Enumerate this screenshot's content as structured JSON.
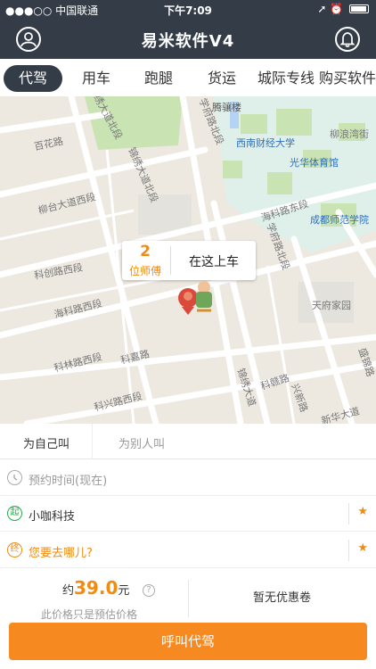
{
  "status_bar": {
    "carrier": "●●●○○ 中国联通",
    "time": "下午7:09",
    "right_icons": "➚ ⏰"
  },
  "header": {
    "title": "易米软件V4",
    "left_icon": "user-icon",
    "right_icon": "bell-icon"
  },
  "tabs": [
    {
      "label": "代驾",
      "active": true
    },
    {
      "label": "用车",
      "active": false
    },
    {
      "label": "跑腿",
      "active": false
    },
    {
      "label": "货运",
      "active": false
    },
    {
      "label": "城际专线",
      "active": false
    },
    {
      "label": "购买软件",
      "active": false
    }
  ],
  "map": {
    "labels": {
      "tengxiang": "腾骧楼",
      "xufu_n": "学府路北段",
      "jinxiu_n": "锦绣大道北段",
      "baihua": "百花路",
      "xinan": "西南财经大学",
      "liuyang": "柳浪湾街",
      "guanghua": "光华体育馆",
      "liutai": "柳台大道西段",
      "jinxiu_nb": "锦绣大道北段",
      "haike_e": "海科路东段",
      "chengdu": "成都师范学院",
      "kechuang": "科创路西段",
      "xuefu": "学府路北段",
      "haike_w": "海科路西段",
      "tianfu": "天府家园",
      "kelin": "科林路西段",
      "kejia": "科嘉路",
      "kejing": "科赣路",
      "yongkang": "盛锦路",
      "kexing": "科兴路西段",
      "jinxiu": "锦绣大道",
      "xingxin": "兴新路",
      "xinhua": "新华大道"
    },
    "driver_count": "2",
    "driver_label": "位师傅",
    "pickup_label": "在这上车",
    "locate_icon": "locate-icon",
    "colors": {
      "park": "#c9e3b3",
      "campus": "#dff0ea",
      "road": "#ffffff",
      "water": "#b5d3f2"
    }
  },
  "order": {
    "tab_self": "为自己叫",
    "tab_other": "为别人叫",
    "schedule_placeholder": "预约时间(现在)",
    "start_location": "小咖科技",
    "destination_placeholder": "您要去哪儿?",
    "price_prefix": "约",
    "price_value": "39.0",
    "price_unit": "元",
    "price_help": "?",
    "price_note": "此价格只是预估价格",
    "coupon": "暂无优惠卷",
    "start_icon_text": "起",
    "end_icon_text": "终",
    "star": "★"
  },
  "actions": {
    "call_button": "呼叫代驾"
  },
  "colors": {
    "header_bg": "#333c47",
    "accent": "#f6891f",
    "start_marker": "#2aa94b",
    "end_marker": "#f28b10"
  }
}
